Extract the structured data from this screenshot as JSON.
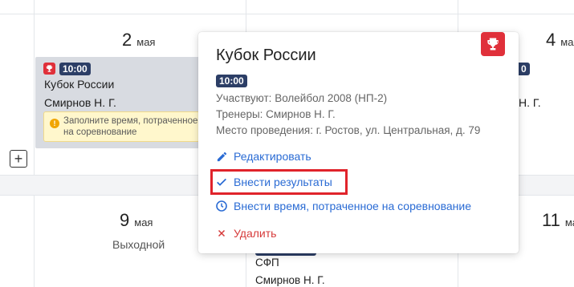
{
  "calendar": {
    "days": [
      {
        "day": "2",
        "month": "мая"
      },
      {
        "day": "4",
        "month": "мая"
      },
      {
        "day": "9",
        "month": "мая",
        "note": "Выходной"
      },
      {
        "day": "11",
        "month": "мая"
      }
    ],
    "event_card": {
      "time": "10:00",
      "title": "Кубок России",
      "coach": "Смирнов Н. Г.",
      "warning": "Заполните время, потраченное на соревнование"
    },
    "right_peek": {
      "time_fragment": "0",
      "coach_fragment": "Н. Г."
    },
    "bottom_event": {
      "title": "СФП",
      "coach": "Смирнов Н. Г."
    },
    "add_label": "+"
  },
  "popover": {
    "title": "Кубок России",
    "time": "10:00",
    "participants": "Участвуют: Волейбол 2008 (НП-2)",
    "coaches": "Тренеры: Смирнов Н. Г.",
    "venue": "Место проведения: г. Ростов, ул. Центральная, д. 79",
    "actions": {
      "edit": "Редактировать",
      "results": "Внести результаты",
      "time_spent": "Внести время, потраченное на соревнование",
      "delete": "Удалить"
    }
  },
  "colors": {
    "accent": "#2a6bd4",
    "danger": "#d63a3a",
    "badge": "#2c3e66",
    "trophy": "#e0303a",
    "highlight": "#e0232b"
  }
}
